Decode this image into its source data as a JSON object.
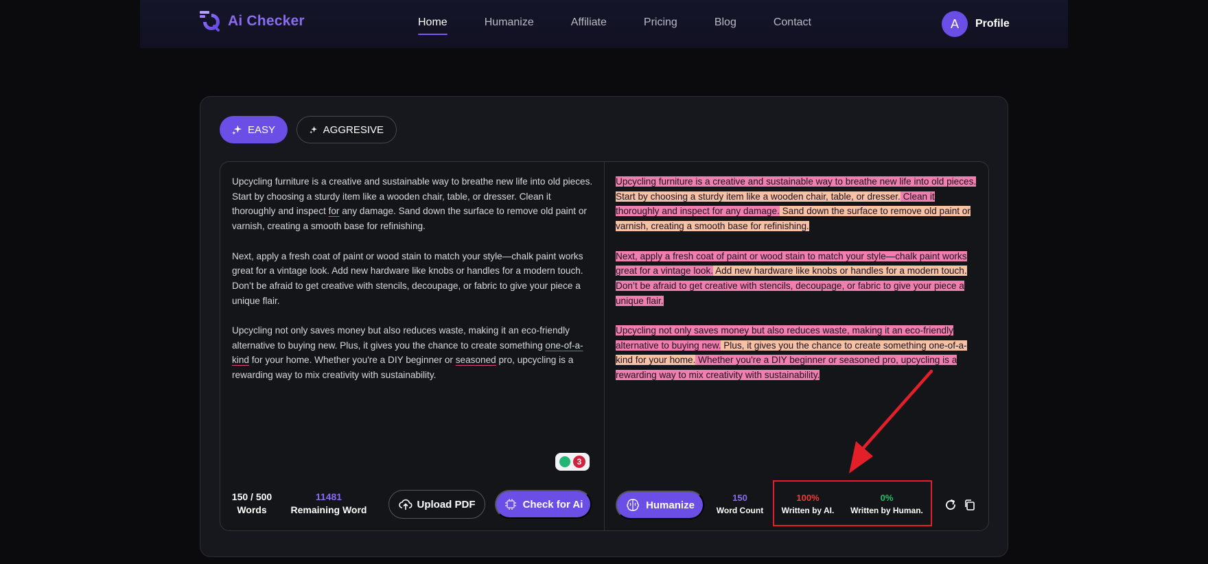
{
  "brand": {
    "name": "Ai Checker",
    "color": "#8a6cf0"
  },
  "nav": {
    "links": [
      {
        "label": "Home",
        "active": true
      },
      {
        "label": "Humanize"
      },
      {
        "label": "Affiliate"
      },
      {
        "label": "Pricing"
      },
      {
        "label": "Blog"
      },
      {
        "label": "Contact"
      }
    ],
    "profile": {
      "initial": "A",
      "label": "Profile"
    }
  },
  "modes": [
    {
      "label": "EASY",
      "icon": "sparkle-icon",
      "selected": true
    },
    {
      "label": "AGGRESIVE",
      "icon": "sparkle-icon",
      "selected": false
    }
  ],
  "input": {
    "paragraphs": [
      [
        {
          "t": "Upcycling furniture is a creative and sustainable way to breathe new life into old pieces. Start by choosing a sturdy item like a wooden chair, table, or dresser. Clean it thoroughly and inspect "
        },
        {
          "t": "for",
          "underline": true
        },
        {
          "t": " any damage. Sand down the surface to remove old paint or varnish, creating a smooth base for refinishing."
        }
      ],
      [
        {
          "t": "Next, apply a fresh coat of paint or wood stain to match your style—chalk paint works great for a vintage look. Add new hardware like knobs or handles for a modern touch. Don’t be afraid to get creative with stencils, decoupage, or fabric to give your piece a unique flair."
        }
      ],
      [
        {
          "t": "Upcycling not only saves money but also reduces waste, making it an eco-friendly alternative to buying new. Plus, it gives you the chance to create something "
        },
        {
          "t": "one-of-a-kind",
          "underline": true
        },
        {
          "t": " for your home. Whether you're a DIY beginner or "
        },
        {
          "t": "seasoned",
          "underline": true
        },
        {
          "t": " pro, upcycling is a rewarding way to mix creativity with sustainability."
        }
      ]
    ],
    "badge_count": "3",
    "words_stat": {
      "value": "150 / 500",
      "label": "Words"
    },
    "remaining_stat": {
      "value": "11481",
      "label": "Remaining Word"
    },
    "upload_label": "Upload PDF",
    "check_label": "Check for Ai"
  },
  "output": {
    "paragraphs": [
      [
        {
          "t": "Upcycling furniture is a creative and sustainable way to breathe new life into old pieces.",
          "hl": "pink"
        },
        {
          "t": " Start by choosing a sturdy item like a wooden chair, table, or dresser.",
          "hl": "peach"
        },
        {
          "t": " Clean it thoroughly and inspect for any damage.",
          "hl": "pink"
        },
        {
          "t": " Sand down the surface to remove old paint or varnish, creating a smooth base for refinishing.",
          "hl": "peach"
        }
      ],
      [
        {
          "t": "Next, apply a fresh coat of paint or wood stain to match your style—chalk paint works great for a vintage look.",
          "hl": "pink"
        },
        {
          "t": " Add new hardware like knobs or handles for a modern touch.",
          "hl": "peach"
        },
        {
          "t": " Don’t be afraid to get creative with stencils, decoupage, or fabric to give your piece a unique flair.",
          "hl": "pink"
        }
      ],
      [
        {
          "t": "Upcycling not only saves money but also reduces waste, making it an eco-friendly alternative to buying new.",
          "hl": "pink"
        },
        {
          "t": " Plus, it gives you the chance to create something one-of-a-kind for your home.",
          "hl": "peach"
        },
        {
          "t": " Whether you're a DIY beginner or seasoned pro, upcycling is a rewarding way to mix creativity with sustainability.",
          "hl": "pink"
        }
      ]
    ],
    "humanize_label": "Humanize",
    "word_count": {
      "value": "150",
      "label": "Word Count"
    },
    "ai_stat": {
      "value": "100%",
      "label": "Written by AI."
    },
    "human_stat": {
      "value": "0%",
      "label": "Written by Human."
    }
  },
  "colors": {
    "accent": "#6a4ee6",
    "highlight_pink": "#f07fb0",
    "highlight_peach": "#f7c2a3",
    "annotation_red": "#e3202a",
    "ai_red": "#ef3b3b",
    "human_green": "#1fbf6a"
  }
}
